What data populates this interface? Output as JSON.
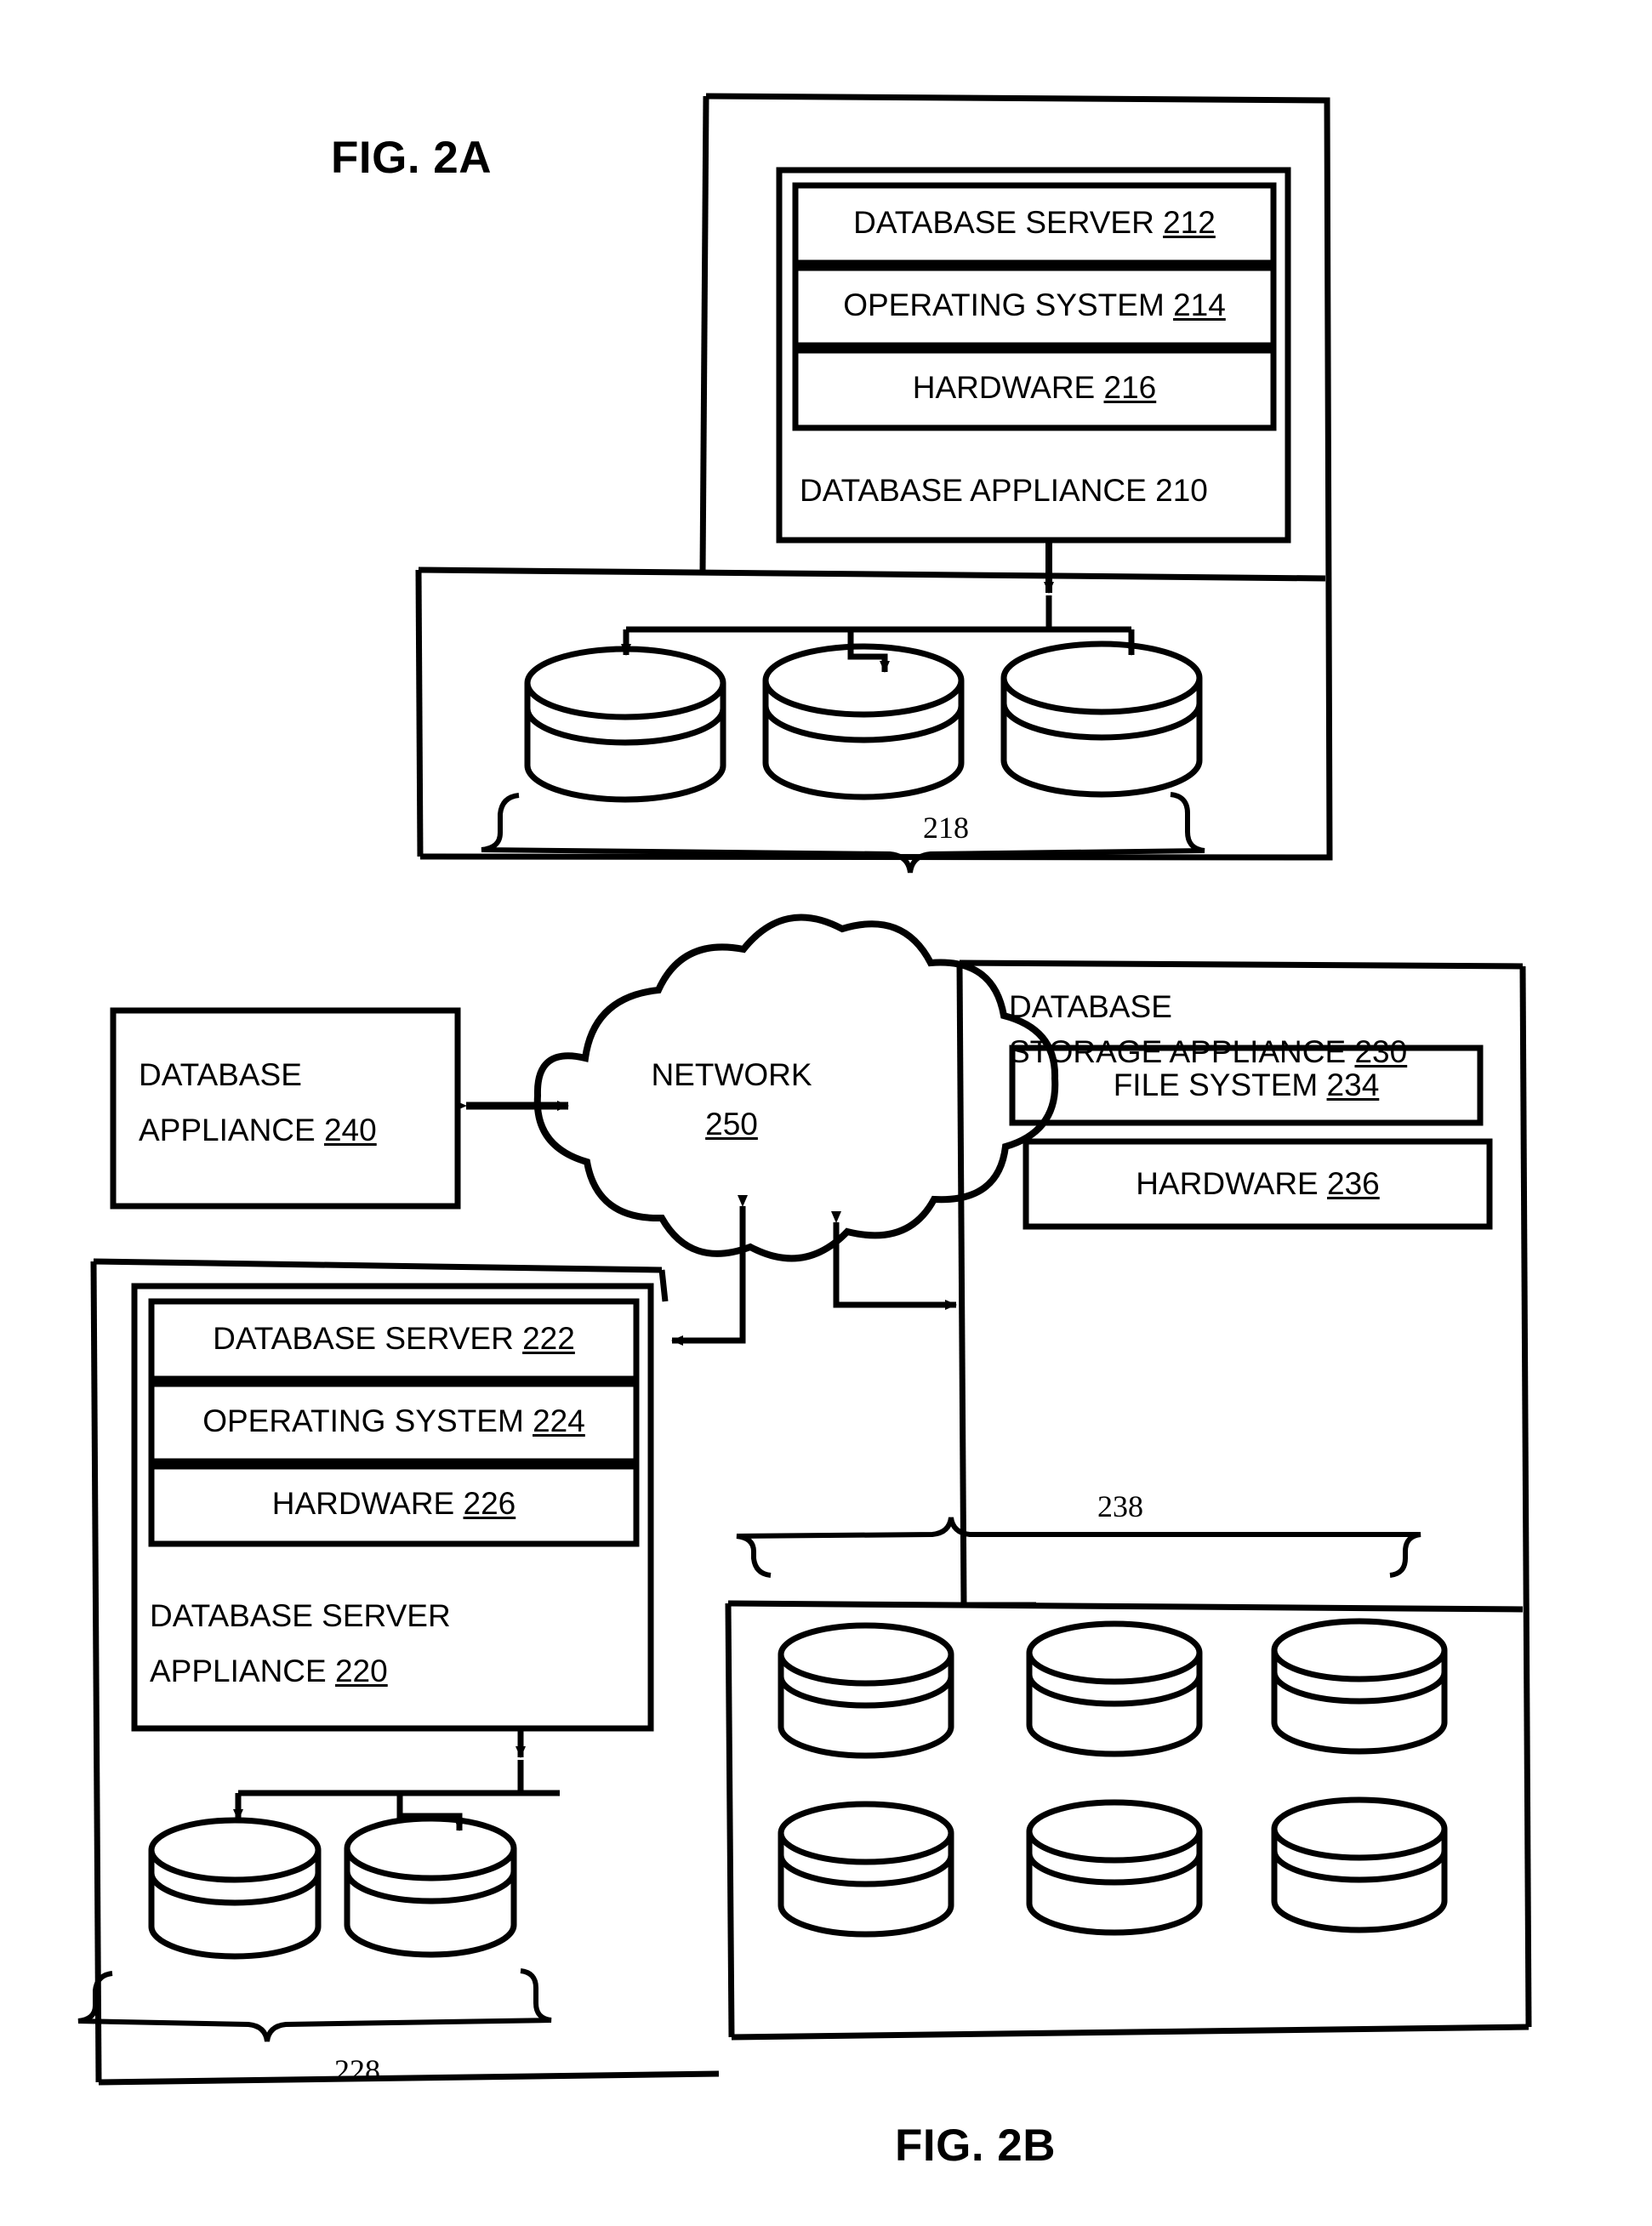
{
  "figures": {
    "fig2a": {
      "caption": "FIG. 2A",
      "appliance": {
        "label": "DATABASE APPLIANCE 210",
        "label_text": "DATABASE APPLIANCE",
        "ref": "210",
        "layers": [
          {
            "text": "DATABASE SERVER",
            "ref": "212",
            "full": "DATABASE SERVER 212"
          },
          {
            "text": "OPERATING SYSTEM",
            "ref": "214",
            "full": "OPERATING SYSTEM 214"
          },
          {
            "text": "HARDWARE",
            "ref": "216",
            "full": "HARDWARE 216"
          }
        ]
      },
      "storage": {
        "ref": "218",
        "disk_count": 3,
        "brace": "below"
      }
    },
    "fig2b": {
      "caption": "FIG. 2B",
      "database_appliance": {
        "line1": "DATABASE",
        "line2": "APPLIANCE",
        "ref": "240",
        "full": "DATABASE APPLIANCE 240"
      },
      "network": {
        "name": "NETWORK",
        "ref": "250",
        "full": "NETWORK 250"
      },
      "server_appliance": {
        "line1": "DATABASE  SERVER",
        "line2": "APPLIANCE",
        "ref": "220",
        "full": "DATABASE SERVER APPLIANCE 220",
        "layers": [
          {
            "text": "DATABASE SERVER",
            "ref": "222",
            "full": "DATABASE SERVER 222"
          },
          {
            "text": "OPERATING SYSTEM",
            "ref": "224",
            "full": "OPERATING SYSTEM 224"
          },
          {
            "text": "HARDWARE",
            "ref": "226",
            "full": "HARDWARE 226"
          }
        ],
        "storage": {
          "ref": "228",
          "disk_count": 2,
          "brace": "below"
        }
      },
      "storage_appliance": {
        "line1": "DATABASE",
        "line2": "STORAGE APPLIANCE",
        "ref": "230",
        "full": "DATABASE STORAGE APPLIANCE 230",
        "layers": [
          {
            "text": "FILE SYSTEM",
            "ref": "234",
            "full": "FILE SYSTEM 234"
          },
          {
            "text": "HARDWARE",
            "ref": "236",
            "full": "HARDWARE 236"
          }
        ],
        "storage": {
          "ref": "238",
          "disk_count": 6,
          "brace": "above"
        }
      }
    }
  },
  "colors": {
    "ink": "#000000",
    "paper": "#ffffff"
  }
}
